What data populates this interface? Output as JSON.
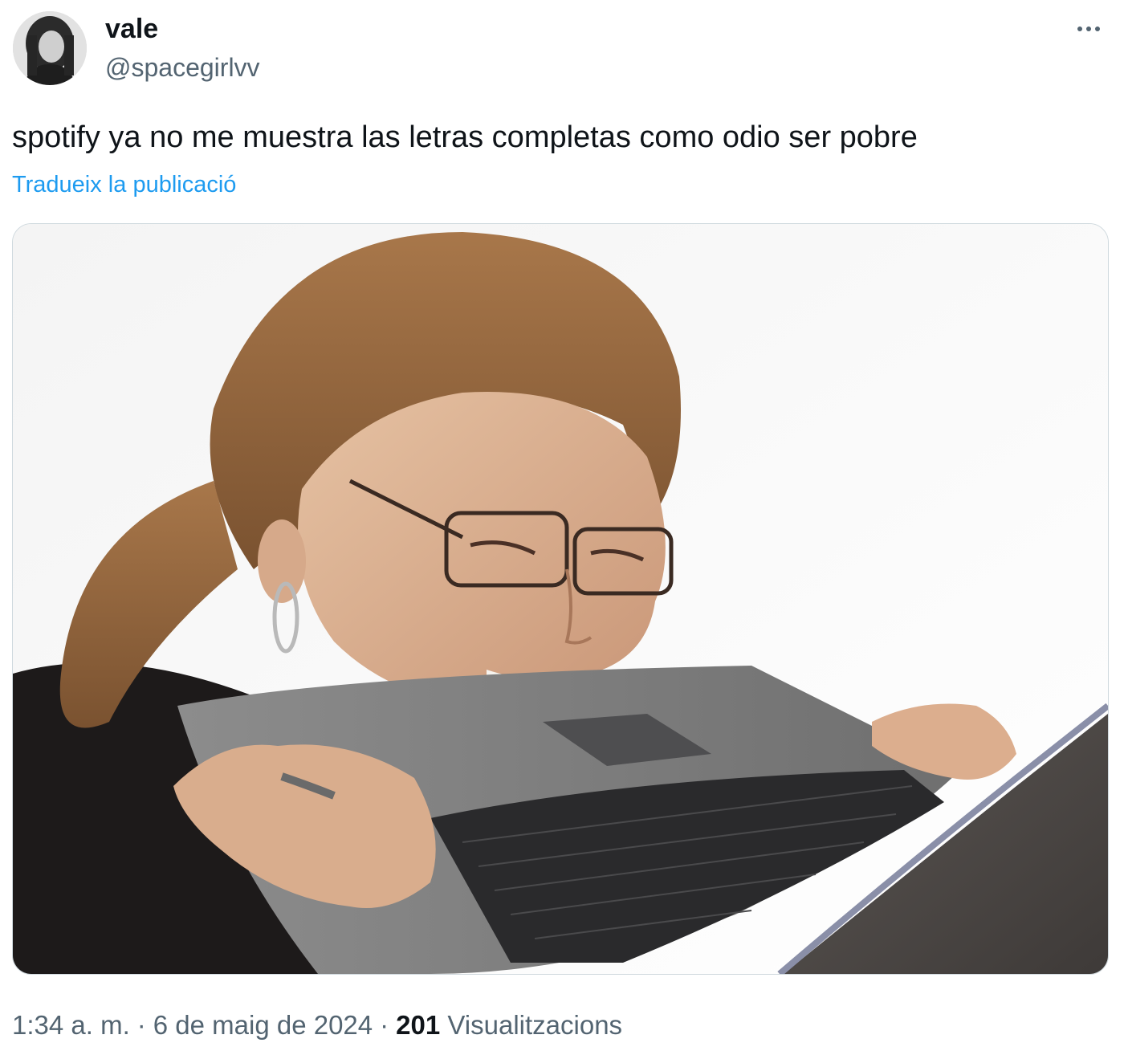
{
  "author": {
    "display_name": "vale",
    "handle": "@spacegirlvv",
    "avatar": "avatar-photo"
  },
  "menu_icon": "more-horizontal-icon",
  "tweet": {
    "text": "spotify ya no me muestra las letras completas como odio ser pobre",
    "translate_label": "Tradueix la publicació",
    "image": "meme-photo-woman-biting-laptop"
  },
  "meta": {
    "time": "1:34 a. m.",
    "separator": "·",
    "date": "6 de maig de 2024",
    "views_count": "201",
    "views_label": "Visualitzacions"
  },
  "colors": {
    "text_primary": "#0f1419",
    "text_secondary": "#536471",
    "link": "#1d9bf0",
    "border": "#cfd9de"
  }
}
